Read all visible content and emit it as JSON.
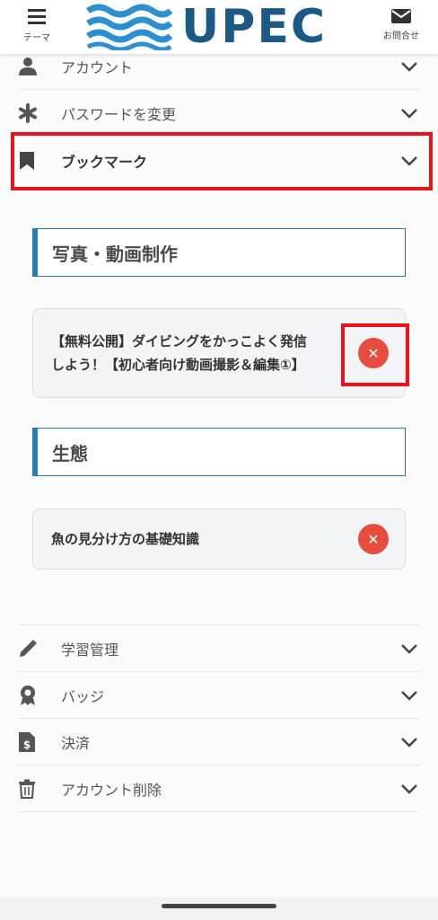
{
  "header": {
    "theme_label": "テーマ",
    "contact_label": "お問合せ",
    "logo_text": "UPEC",
    "brand_color": "#1c5a86"
  },
  "menu_top": [
    {
      "label": "アカウント",
      "icon": "person-icon"
    },
    {
      "label": "パスワードを変更",
      "icon": "asterisk-icon"
    },
    {
      "label": "ブックマーク",
      "icon": "bookmark-icon"
    }
  ],
  "bookmarks": {
    "sections": [
      {
        "title": "写真・動画制作",
        "items": [
          {
            "title_line1": "【無料公開】ダイビングをかっこよく発信",
            "title_line2": "しよう！【初心者向け動画撮影＆編集①】"
          }
        ]
      },
      {
        "title": "生態",
        "items": [
          {
            "title_line1": "魚の見分け方の基礎知識",
            "title_line2": ""
          }
        ]
      }
    ],
    "delete_glyph": "✕"
  },
  "menu_bottom": [
    {
      "label": "学習管理",
      "icon": "pencil-icon"
    },
    {
      "label": "バッジ",
      "icon": "badge-icon"
    },
    {
      "label": "決済",
      "icon": "invoice-icon"
    },
    {
      "label": "アカウント削除",
      "icon": "trash-icon"
    }
  ],
  "colors": {
    "accent": "#2b7ab3",
    "delete": "#e84c3d",
    "highlight": "#e8141c"
  }
}
